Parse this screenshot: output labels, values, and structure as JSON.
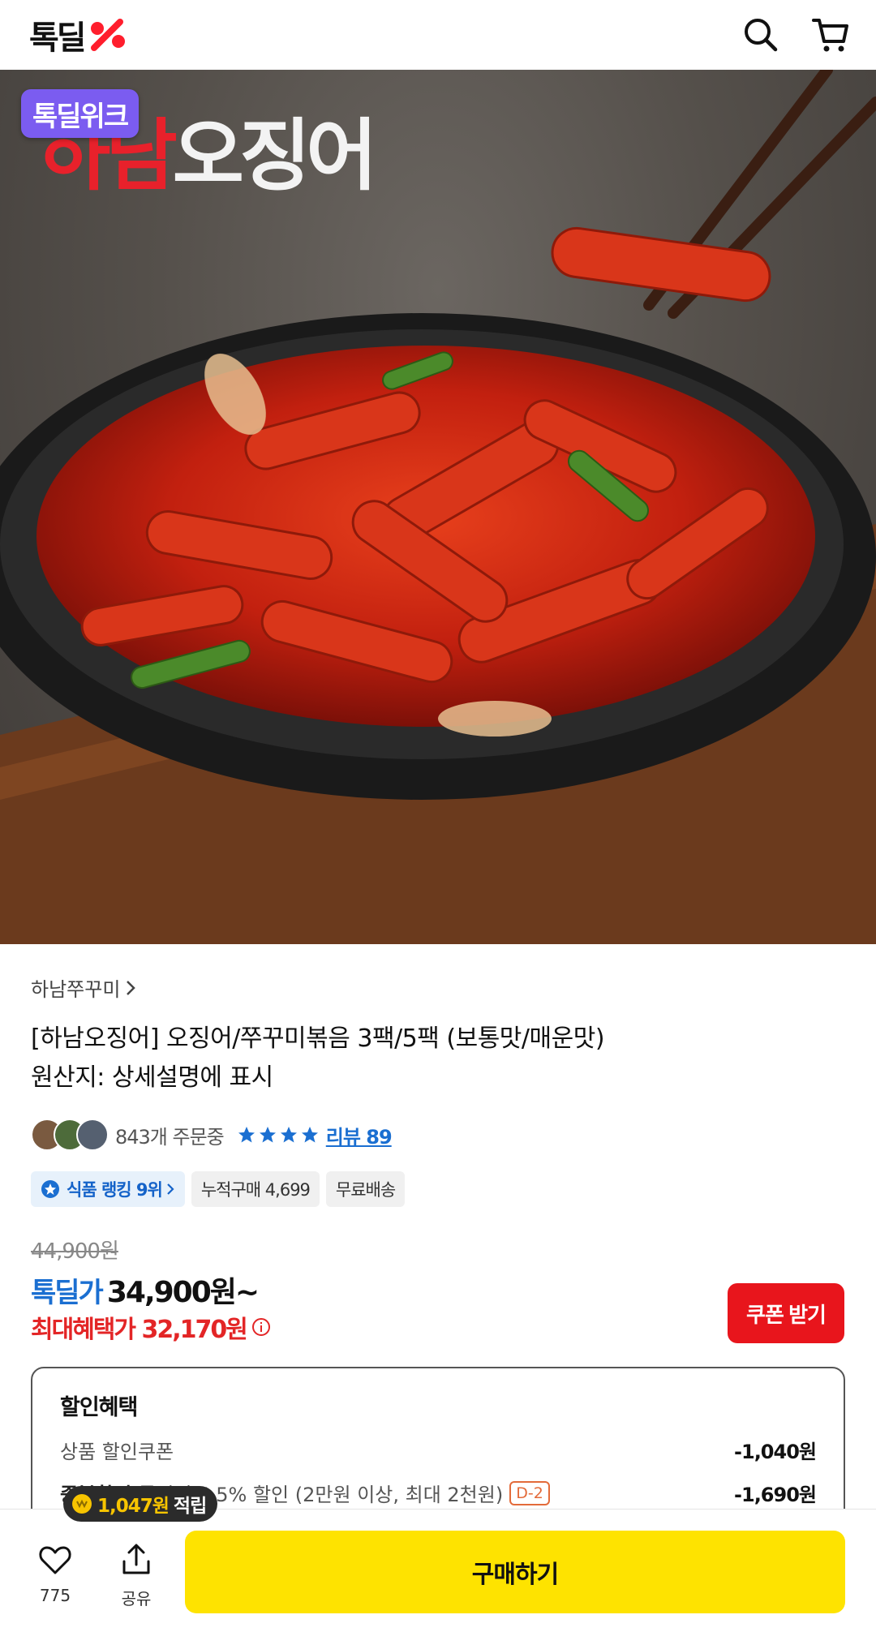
{
  "header": {
    "logo_text": "톡딜",
    "icons": [
      "search-icon",
      "cart-icon"
    ]
  },
  "hero": {
    "badge": "톡딜위크",
    "title_red": "하남",
    "title_white": "오징어"
  },
  "product": {
    "brand": "하남쭈꾸미",
    "name": "[하남오징어] 오징어/쭈꾸미볶음 3팩/5팩 (보통맛/매운맛)",
    "origin": "원산지: 상세설명에 표시",
    "orders": "843개 주문중",
    "rating_stars": 4,
    "review_link": "리뷰 89",
    "chips": {
      "rank": "식품 랭킹 9위",
      "cumulative": "누적구매 4,699",
      "shipping": "무료배송"
    }
  },
  "price": {
    "original": "44,900원",
    "deal_label": "톡딜가",
    "deal_price": "34,900원~",
    "max_benefit": "최대혜택가 32,170원",
    "coupon_button": "쿠폰 받기"
  },
  "benefits": {
    "title": "할인혜택",
    "rows": [
      {
        "label": "상품 할인쿠폰",
        "amount": "-1,040원"
      },
      {
        "strong": "중복할인",
        "label": "톡딜위크 5% 할인 (2만원 이상, 최대 2천원)",
        "dday": "D-2",
        "amount": "-1,690원"
      }
    ]
  },
  "points": {
    "amount": "1,047원",
    "label": "적립"
  },
  "bottom_bar": {
    "like_count": "775",
    "share_label": "공유",
    "buy_label": "구매하기"
  },
  "colors": {
    "deal_blue": "#1b6fd1",
    "sale_red": "#e32526",
    "buy_yellow": "#fee300",
    "badge_purple": "#7b5cf0"
  }
}
